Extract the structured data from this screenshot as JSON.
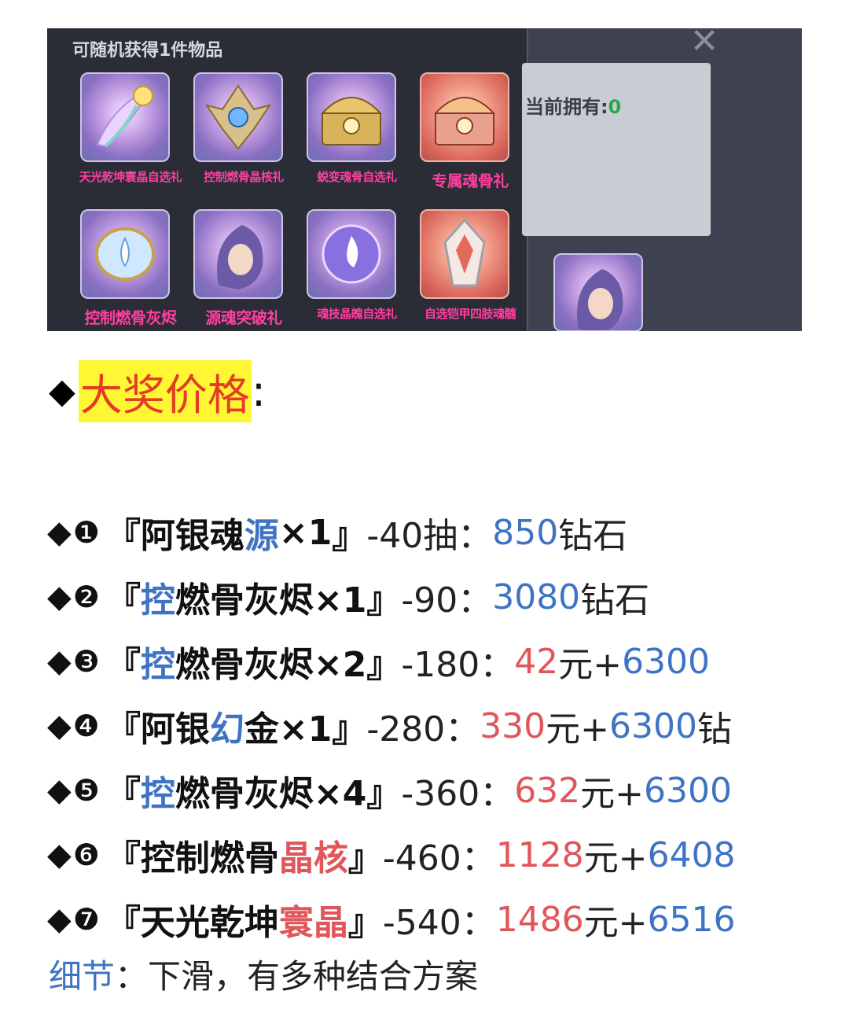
{
  "game_panel": {
    "title": "可随机获得1件物品",
    "items": [
      {
        "label": "天光乾坤寰晶自选礼",
        "icon": "winged-crystal-icon"
      },
      {
        "label": "控制燃骨晶核礼",
        "icon": "armor-crest-icon"
      },
      {
        "label": "蜕变魂骨自选礼",
        "icon": "treasure-chest-icon"
      },
      {
        "label": "专属魂骨礼",
        "icon": "red-treasure-chest-icon"
      },
      {
        "label": "控制燃骨灰烬",
        "icon": "lotus-orb-icon"
      },
      {
        "label": "源魂突破礼",
        "icon": "character-portrait-icon"
      },
      {
        "label": "魂技晶魄自选礼",
        "icon": "flame-orb-icon"
      },
      {
        "label": "自选铠甲四肢魂髓",
        "icon": "silver-crest-icon"
      }
    ],
    "own_label": "当前拥有:",
    "own_value": "0",
    "close_glyph": "✕"
  },
  "article": {
    "diamond": "◆",
    "title": "大奖价格",
    "title_colon": ":",
    "prices": [
      {
        "num": "❶",
        "open": "『",
        "name_a": "阿银魂",
        "name_b": "源",
        "name_c": "×1",
        "close": "』",
        "cost": "-40抽：",
        "p1": "850",
        "p1_unit": "钻石",
        "p2": "",
        "p2_unit": ""
      },
      {
        "num": "❷",
        "open": "『",
        "name_a": "",
        "name_b": "控",
        "name_c": "燃骨灰烬×1",
        "close": "』",
        "cost": "-90：",
        "p1": "3080",
        "p1_unit": "钻石",
        "p2": "",
        "p2_unit": ""
      },
      {
        "num": "❸",
        "open": "『",
        "name_a": "",
        "name_b": "控",
        "name_c": "燃骨灰烬×2",
        "close": "』",
        "cost": "-180：",
        "p1": "42",
        "p1_unit": "元+",
        "p2": "6300",
        "p2_unit": ""
      },
      {
        "num": "❹",
        "open": "『",
        "name_a": "阿银",
        "name_b": "幻",
        "name_c": "金×1",
        "close": "』",
        "cost": "-280：",
        "p1": "330",
        "p1_unit": "元+",
        "p2": "6300",
        "p2_unit": "钻"
      },
      {
        "num": "❺",
        "open": "『",
        "name_a": "",
        "name_b": "控",
        "name_c": "燃骨灰烬×4",
        "close": "』",
        "cost": "-360：",
        "p1": "632",
        "p1_unit": "元+",
        "p2": "6300",
        "p2_unit": ""
      },
      {
        "num": "❻",
        "open": "『",
        "name_a": "控制燃骨",
        "name_b": "晶核",
        "name_c": "",
        "close": "』",
        "cost": "-460：",
        "p1": "1128",
        "p1_unit": "元+",
        "p2": "6408",
        "p2_unit": ""
      },
      {
        "num": "❼",
        "open": "『",
        "name_a": "天光乾坤",
        "name_b": "寰晶",
        "name_c": "",
        "close": "』",
        "cost": "-540：",
        "p1": "1486",
        "p1_unit": "元+",
        "p2": "6516",
        "p2_unit": ""
      }
    ],
    "detail_label": "细节",
    "detail_text": "：下滑，有多种结合方案"
  }
}
